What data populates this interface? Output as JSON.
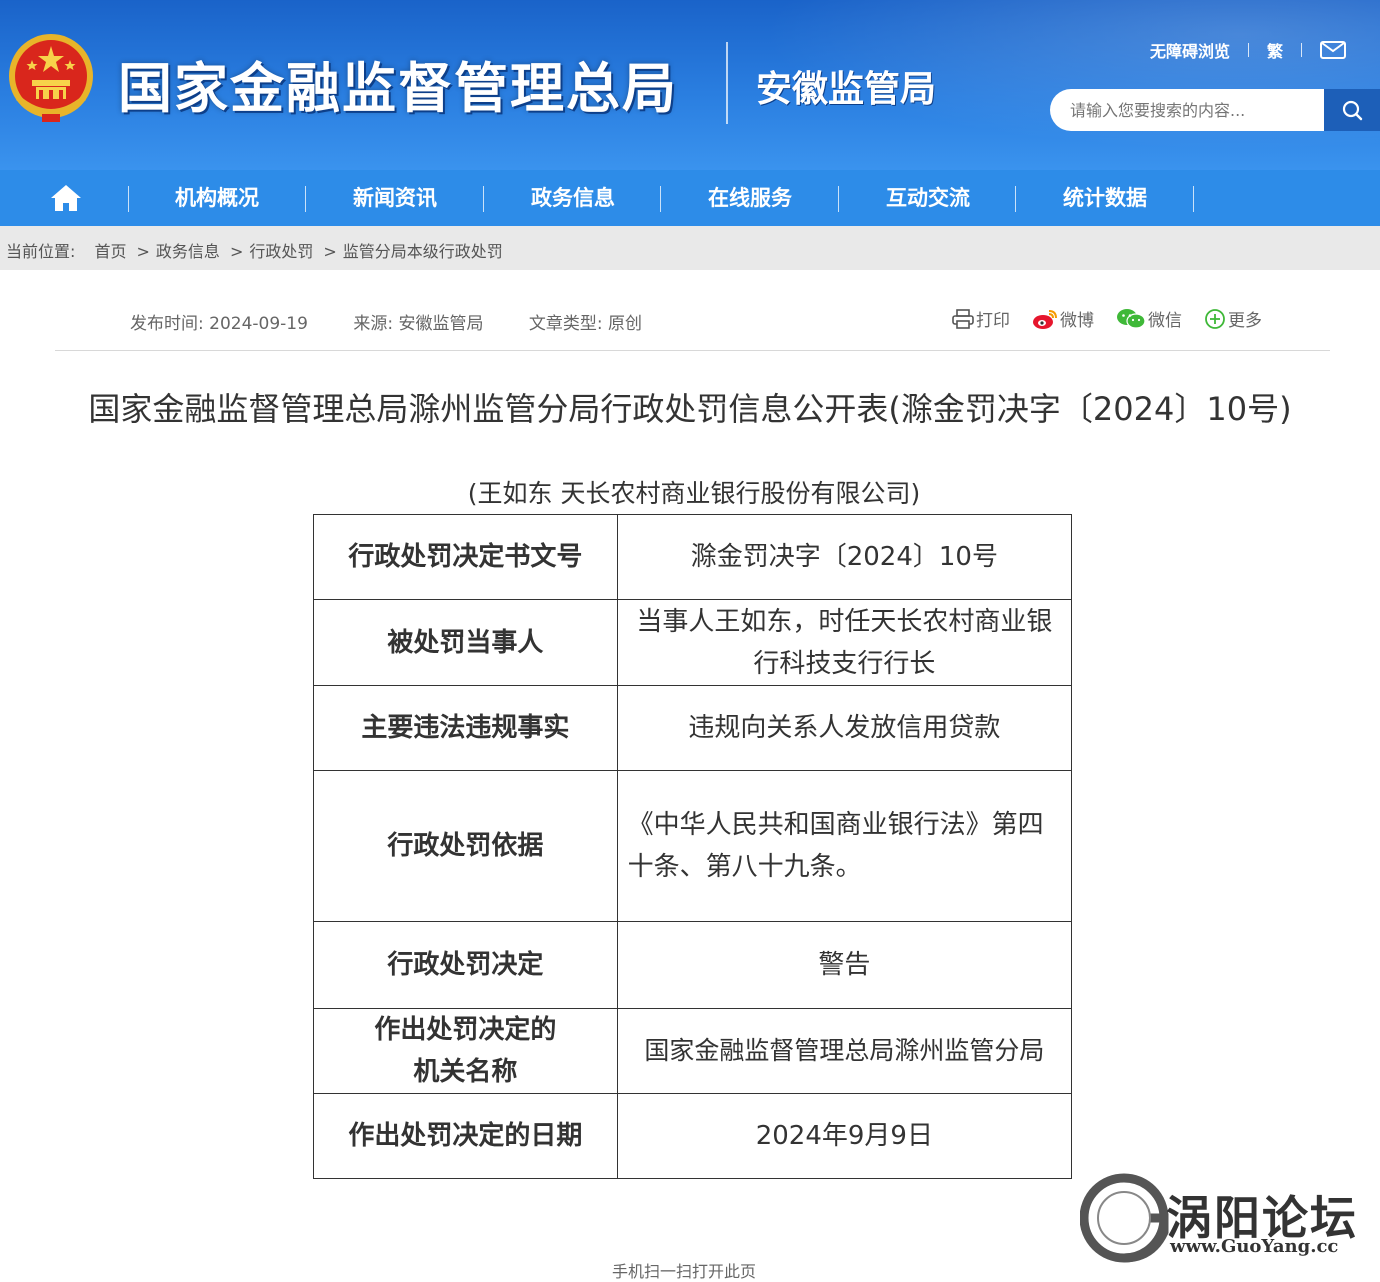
{
  "header": {
    "site_title": "国家金融监督管理总局",
    "branch_title": "安徽监管局",
    "accessibility_link": "无障碍浏览",
    "traditional_link": "繁",
    "search_placeholder": "请输入您要搜索的内容...",
    "colors": {
      "header_blue": "#1a63c9",
      "nav_blue": "#2d8ce8",
      "search_button": "#1d5fb8"
    }
  },
  "nav": {
    "items": [
      "机构概况",
      "新闻资讯",
      "政务信息",
      "在线服务",
      "互动交流",
      "统计数据"
    ]
  },
  "breadcrumb": {
    "label": "当前位置:",
    "items": [
      "首页",
      "政务信息",
      "行政处罚",
      "监管分局本级行政处罚"
    ],
    "separator": ">"
  },
  "article": {
    "publish_time": "发布时间:  2024-09-19",
    "source": "来源:  安徽监管局",
    "type": "文章类型:  原创",
    "share": {
      "print": "打印",
      "weibo": "微博",
      "wechat": "微信",
      "more": "更多"
    },
    "title": "国家金融监督管理总局滁州监管分局行政处罚信息公开表(滁金罚决字〔2024〕10号)",
    "subtitle": "(王如东 天长农村商业银行股份有限公司)",
    "table": [
      {
        "key": "行政处罚决定书文号",
        "value": "滁金罚决字〔2024〕10号"
      },
      {
        "key": "被处罚当事人",
        "value": "当事人王如东，时任天长农村商业银行科技支行行长"
      },
      {
        "key": "主要违法违规事实",
        "value": "违规向关系人发放信用贷款"
      },
      {
        "key": "行政处罚依据",
        "value": "《中华人民共和国商业银行法》第四十条、第八十九条。"
      },
      {
        "key": "行政处罚决定",
        "value": "警告"
      },
      {
        "key": "作出处罚决定的机关名称",
        "value": "国家金融监督管理总局滁州监管分局"
      },
      {
        "key": "作出处罚决定的日期",
        "value": "2024年9月9日"
      }
    ]
  },
  "watermark": {
    "name": "涡阳论坛",
    "url": "www.GuoYang.cc"
  },
  "footer_partial": "手机扫一扫打开此页"
}
